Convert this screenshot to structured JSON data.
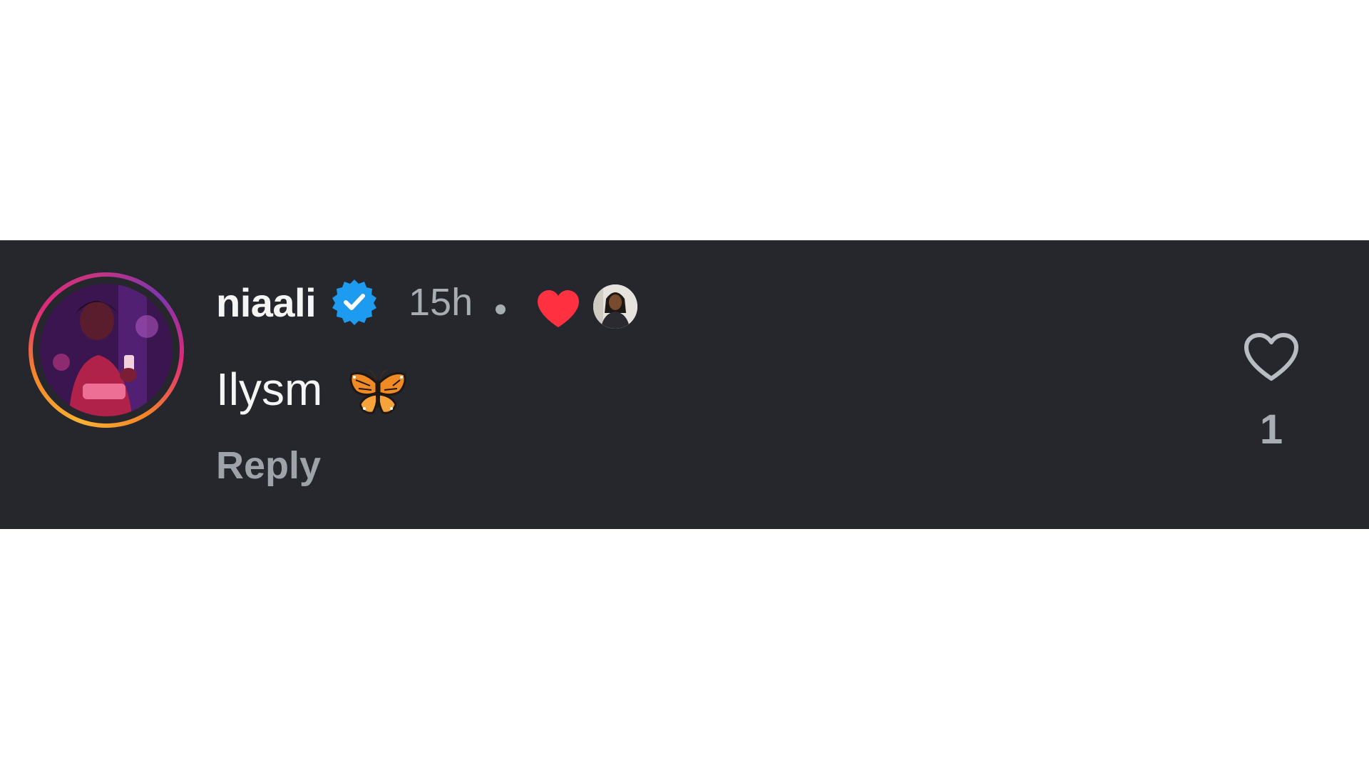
{
  "comment": {
    "username": "niaali",
    "verified": true,
    "timestamp": "15h",
    "separator": "•",
    "creator_liked": true,
    "text": "Ilysm",
    "emoji_name": "butterfly-emoji",
    "reply_label": "Reply",
    "like_count": "1"
  },
  "icons": {
    "verified": "verified-badge-icon",
    "liked_by_creator": "heart-icon",
    "like": "heart-outline-icon"
  },
  "colors": {
    "background_bar": "#25272c",
    "username": "#f5f5f5",
    "secondary_text": "#a8acb3",
    "verified_blue": "#1d9bf0",
    "like_red": "#ff3040",
    "story_ring_start": "#f9b233",
    "story_ring_end": "#c13584"
  }
}
